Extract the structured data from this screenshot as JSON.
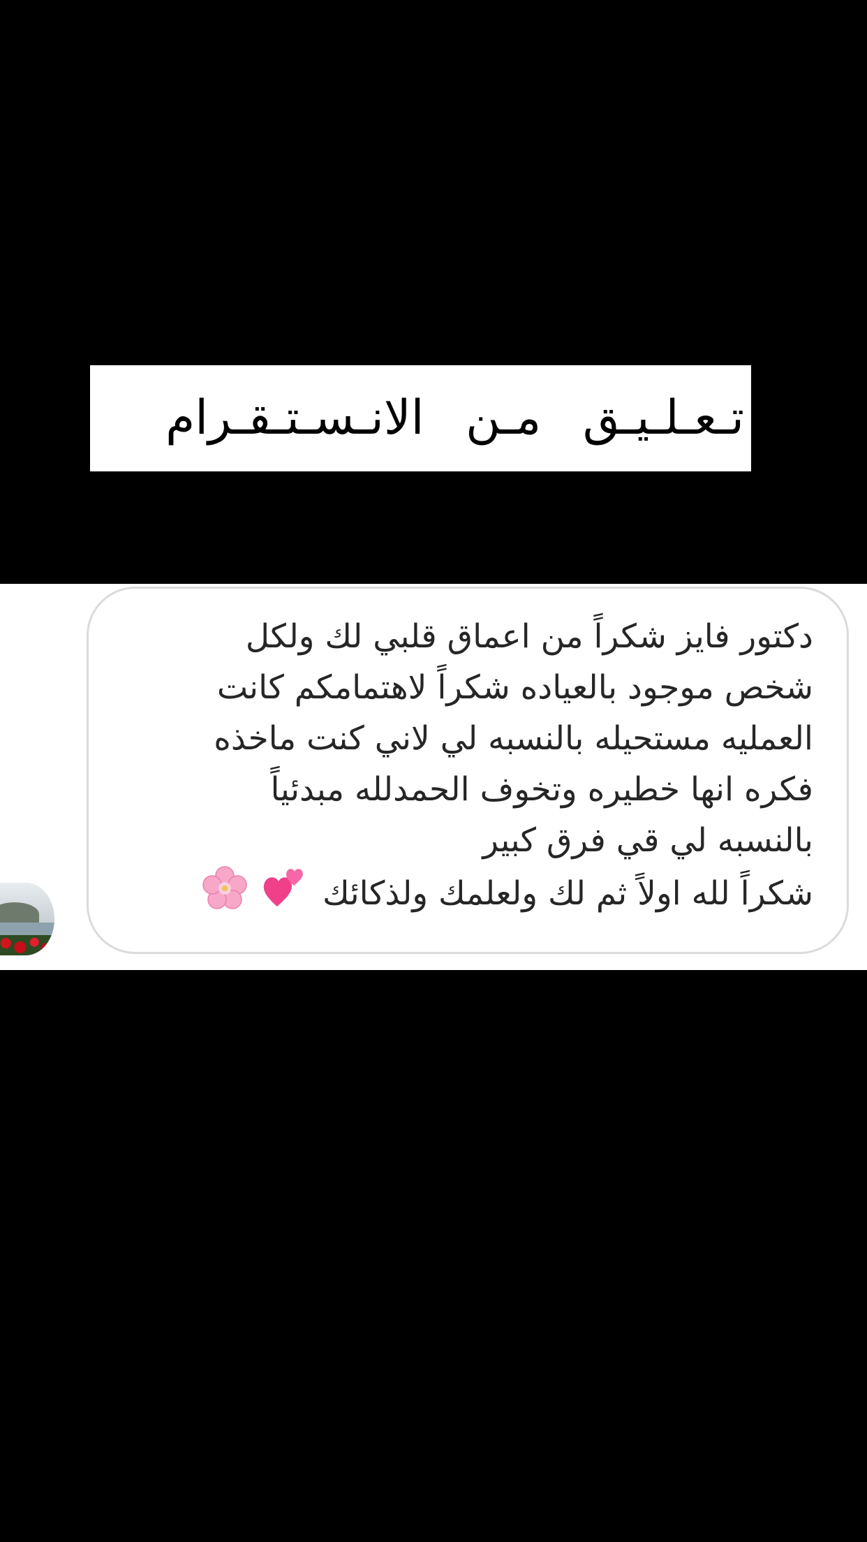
{
  "title": "تـعـلـيـق  مـن  الانـسـتـقـرام",
  "comment": {
    "lines": [
      "دكتور فايز شكراً من اعماق قلبي لك ولكل",
      "شخص موجود بالعياده شكراً لاهتمامكم كانت",
      "العمليه مستحيله بالنسبه لي لاني كنت ماخذه",
      "فكره انها خطيره وتخوف الحمدلله مبدئياً",
      "بالنسبه لي قي فرق كبير",
      "شكراً لله اولاً ثم لك ولعلمك ولذكائك"
    ],
    "emojis": [
      "two-hearts-emoji",
      "cherry-blossom-emoji"
    ]
  },
  "colors": {
    "background": "#000000",
    "title_box": "#ffffff",
    "bubble_border": "#dbdbdb",
    "text": "#262626"
  }
}
